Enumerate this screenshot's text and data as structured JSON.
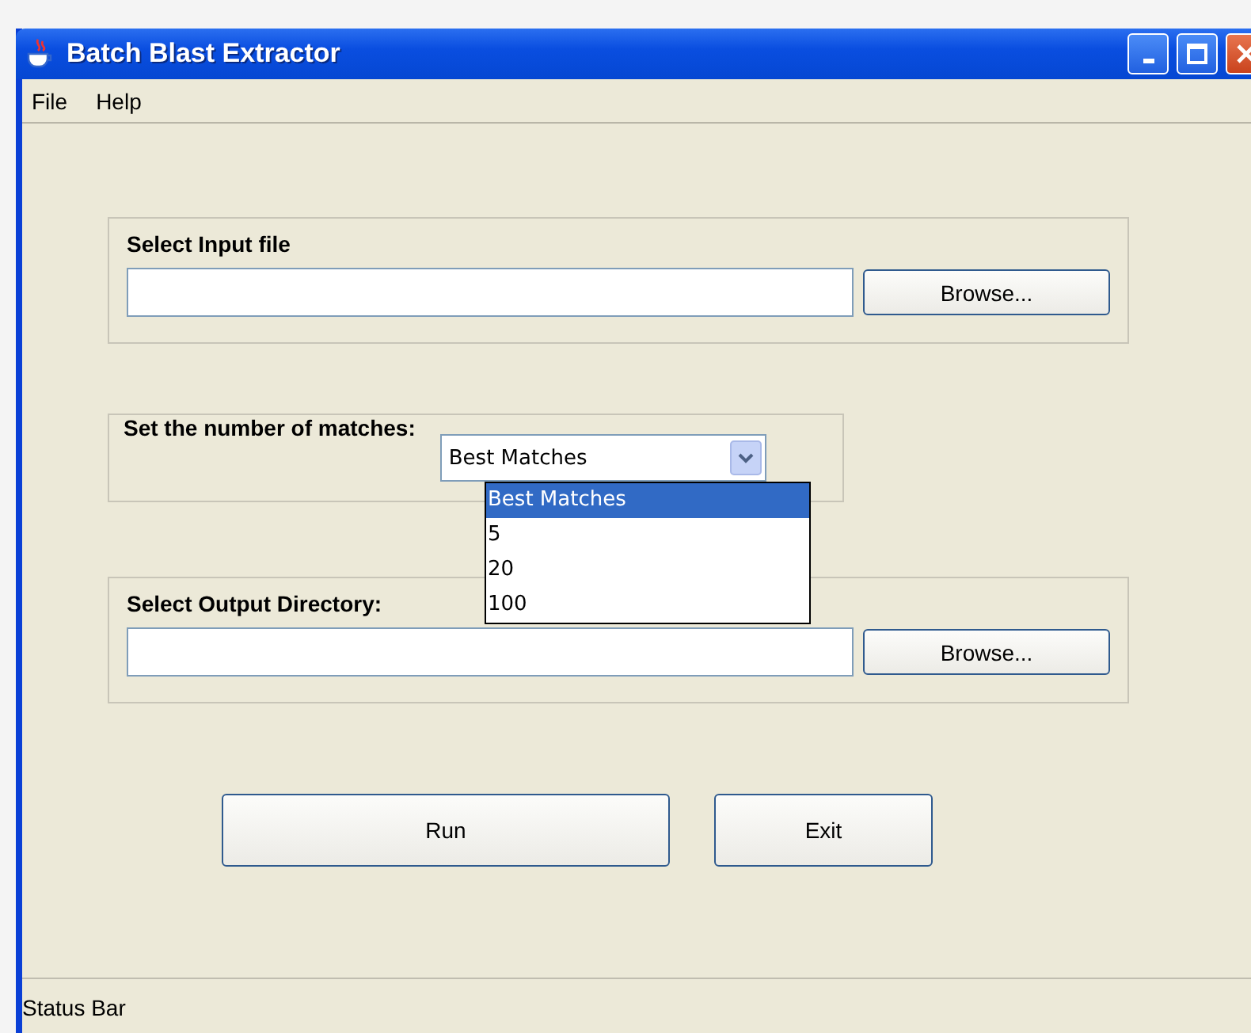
{
  "window": {
    "title": "Batch Blast Extractor"
  },
  "menu": [
    "File",
    "Help"
  ],
  "input_section": {
    "label": "Select Input file",
    "button": "Browse..."
  },
  "matches_section": {
    "label": "Set the number of matches:",
    "combo_value": "Best Matches",
    "expanded": true,
    "options": [
      {
        "label": "Best Matches",
        "selected": true
      },
      {
        "label": "5",
        "selected": false
      },
      {
        "label": "20",
        "selected": false
      },
      {
        "label": "100",
        "selected": false
      }
    ]
  },
  "output_section": {
    "label": "Select Output Directory:",
    "button": "Browse..."
  },
  "buttons": [
    "Run",
    "Exit"
  ],
  "status_bar": "Status Bar"
}
